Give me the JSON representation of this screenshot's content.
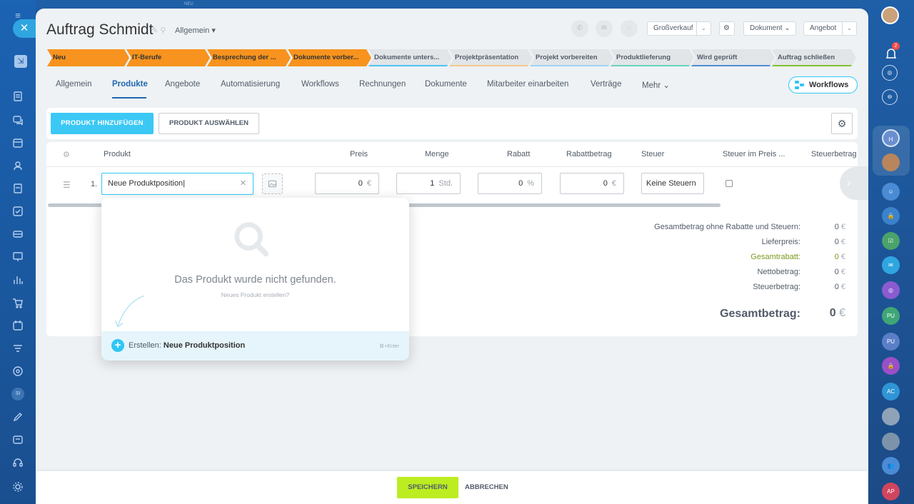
{
  "deal": {
    "title": "Auftrag Schmidt",
    "category": "Allgemein"
  },
  "header": {
    "pipeline": "Großverkauf",
    "document": "Dokument",
    "offer": "Angebot"
  },
  "stages": [
    {
      "label": "Neu",
      "done": true,
      "color": "#f7931e"
    },
    {
      "label": "IT-Berufe",
      "done": true,
      "color": "#f7931e"
    },
    {
      "label": "Besprechung der ...",
      "done": true,
      "color": "#f7931e"
    },
    {
      "label": "Dokumente vorber...",
      "done": true,
      "color": "#f7931e"
    },
    {
      "label": "Dokumente unters...",
      "done": false,
      "color": "#4fc3f7"
    },
    {
      "label": "Projektpräsentation",
      "done": false,
      "color": "#f3c98b"
    },
    {
      "label": "Projekt vorbereiten",
      "done": false,
      "color": "#9fd4f3"
    },
    {
      "label": "Produktlieferung",
      "done": false,
      "color": "#6ad2c2"
    },
    {
      "label": "Wird geprüft",
      "done": false,
      "color": "#4f8fd6"
    },
    {
      "label": "Auftrag schließen",
      "done": false,
      "color": "#86c033"
    }
  ],
  "tabs": [
    "Allgemein",
    "Produkte",
    "Angebote",
    "Automatisierung",
    "Workflows",
    "Rechnungen",
    "Dokumente",
    "Mitarbeiter einarbeiten",
    "Verträge",
    "Mehr"
  ],
  "active_tab": "Produkte",
  "workflows_button": "Workflows",
  "toolbar": {
    "add_product": "PRODUKT HINZUFÜGEN",
    "select_product": "PRODUKT AUSWÄHLEN"
  },
  "table": {
    "columns": [
      "Produkt",
      "Preis",
      "Menge",
      "Rabatt",
      "Rabattbetrag",
      "Steuer",
      "Steuer im Preis ...",
      "Steuerbetrag"
    ],
    "row": {
      "number": "1.",
      "product": "Neue Produktposition",
      "price": "0",
      "price_unit": "€",
      "quantity": "1",
      "quantity_unit": "Std.",
      "discount": "0",
      "discount_unit": "%",
      "discount_amount": "0",
      "discount_amount_unit": "€",
      "tax": "Keine Steuern"
    }
  },
  "totals": {
    "rows": [
      {
        "label": "Gesamtbetrag ohne Rabatte und Steuern:",
        "value": "0"
      },
      {
        "label": "Lieferpreis:",
        "value": "0"
      },
      {
        "label": "Gesamtrabatt:",
        "value": "0"
      },
      {
        "label": "Nettobetrag:",
        "value": "0"
      },
      {
        "label": "Steuerbetrag:",
        "value": "0"
      }
    ],
    "currency": "€",
    "grand_label": "Gesamtbetrag:",
    "grand_value": "0"
  },
  "dropdown": {
    "empty_title": "Das Produkt wurde nicht gefunden.",
    "empty_sub": "Neues Produkt erstellen?",
    "create_label": "Erstellen:",
    "create_value": "Neue Produktposition",
    "hint": "⌘+Enter"
  },
  "footer": {
    "save": "SPEICHERN",
    "cancel": "ABBRECHEN"
  },
  "nav": {
    "notification_count": "2",
    "user_initials": [
      "PU",
      "PU",
      "AC",
      "AP"
    ],
    "left_initials": "SI",
    "new_badge": "NEU"
  }
}
